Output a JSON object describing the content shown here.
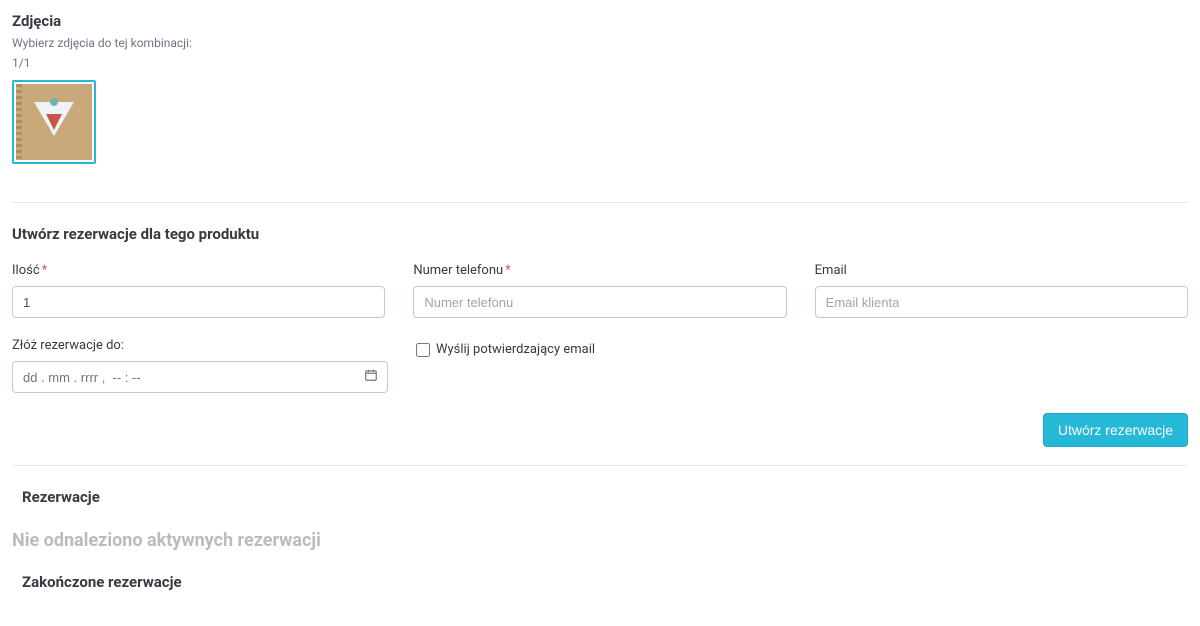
{
  "photos": {
    "title": "Zdjęcia",
    "helper": "Wybierz zdjęcia do tej kombinacji:",
    "counter": "1/1"
  },
  "reservation_form": {
    "title": "Utwórz rezerwacje dla tego produktu",
    "quantity_label": "Ilość",
    "quantity_value": "1",
    "phone_label": "Numer telefonu",
    "phone_placeholder": "Numer telefonu",
    "email_label": "Email",
    "email_placeholder": "Email klienta",
    "date_label": "Złóż rezerwacje do:",
    "date_placeholder": "dd . mm . rrrr ,  -- : --",
    "send_email_label": "Wyślij potwierdzający email",
    "submit_label": "Utwórz rezerwacje"
  },
  "reservations": {
    "title": "Rezerwacje",
    "empty": "Nie odnaleziono aktywnych rezerwacji",
    "completed_title": "Zakończone rezerwacje"
  }
}
